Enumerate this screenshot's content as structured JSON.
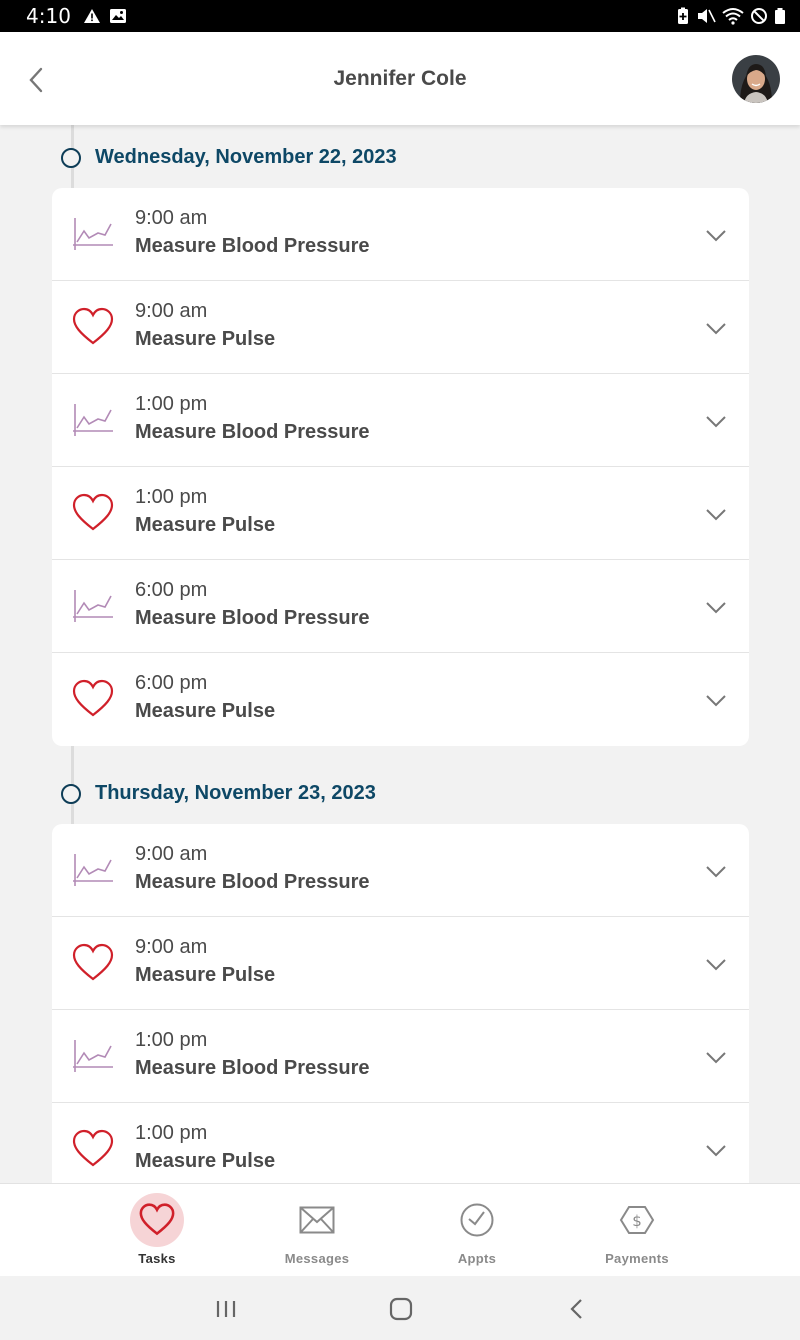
{
  "status_bar": {
    "time": "4:10"
  },
  "header": {
    "title": "Jennifer Cole"
  },
  "colors": {
    "accent": "#0e4866",
    "heart": "#d0202a",
    "chart": "#b28ab6",
    "tasks_active_bg": "#f6d4d6"
  },
  "days": [
    {
      "title": "Wednesday, November 22, 2023",
      "tasks": [
        {
          "time": "9:00 am",
          "name": "Measure Blood Pressure",
          "icon": "chart-icon"
        },
        {
          "time": "9:00 am",
          "name": "Measure Pulse",
          "icon": "heart-icon"
        },
        {
          "time": "1:00 pm",
          "name": "Measure Blood Pressure",
          "icon": "chart-icon"
        },
        {
          "time": "1:00 pm",
          "name": "Measure Pulse",
          "icon": "heart-icon"
        },
        {
          "time": "6:00 pm",
          "name": "Measure Blood Pressure",
          "icon": "chart-icon"
        },
        {
          "time": "6:00 pm",
          "name": "Measure Pulse",
          "icon": "heart-icon"
        }
      ]
    },
    {
      "title": "Thursday, November 23, 2023",
      "tasks": [
        {
          "time": "9:00 am",
          "name": "Measure Blood Pressure",
          "icon": "chart-icon"
        },
        {
          "time": "9:00 am",
          "name": "Measure Pulse",
          "icon": "heart-icon"
        },
        {
          "time": "1:00 pm",
          "name": "Measure Blood Pressure",
          "icon": "chart-icon"
        },
        {
          "time": "1:00 pm",
          "name": "Measure Pulse",
          "icon": "heart-icon"
        }
      ]
    }
  ],
  "nav": {
    "tasks": "Tasks",
    "messages": "Messages",
    "appts": "Appts",
    "payments": "Payments",
    "active": "Tasks"
  }
}
